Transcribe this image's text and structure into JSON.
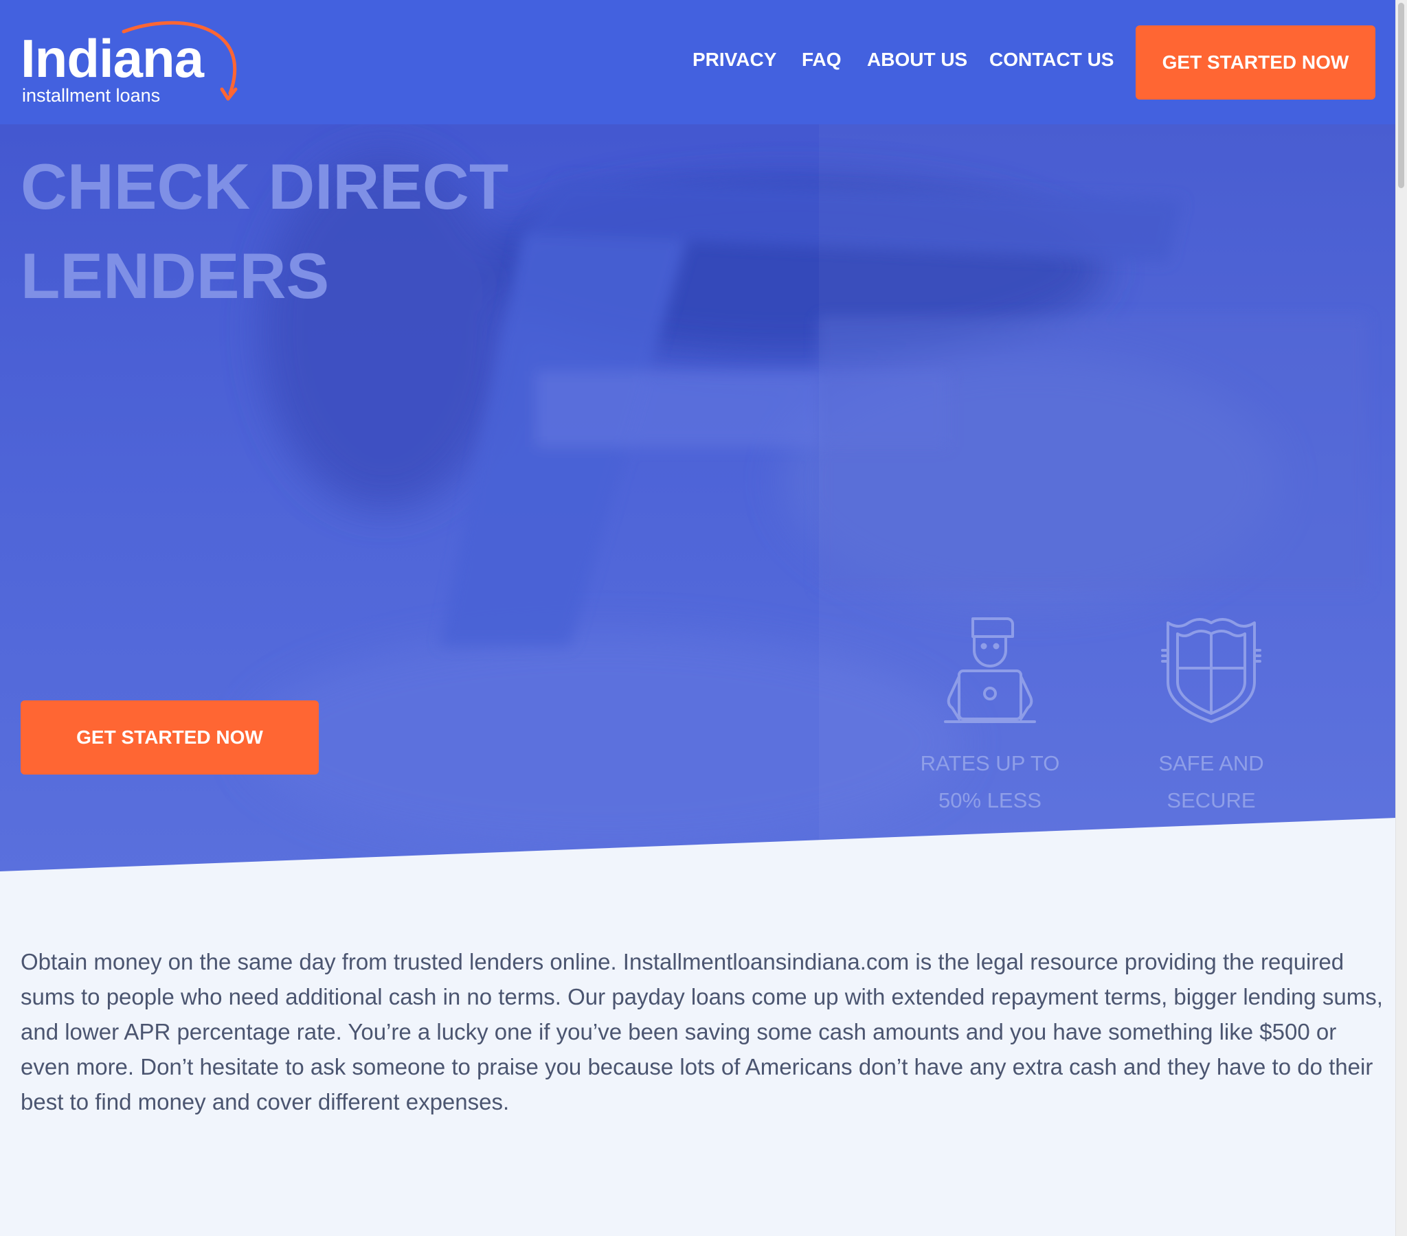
{
  "brand": {
    "name": "Indiana",
    "tagline": "installment loans"
  },
  "nav": {
    "items": [
      {
        "label": "PRIVACY"
      },
      {
        "label": "FAQ"
      },
      {
        "label": "ABOUT US"
      },
      {
        "label": "CONTACT US"
      }
    ],
    "cta_label": "GET STARTED NOW"
  },
  "hero": {
    "title_line1": "CHECK DIRECT",
    "title_line2": "LENDERS",
    "cta_label": "GET STARTED NOW",
    "features": [
      {
        "icon": "person-laptop-icon",
        "label": "RATES UP TO\n50% LESS"
      },
      {
        "icon": "shield-icon",
        "label": "SAFE AND\nSECURE"
      }
    ]
  },
  "content": {
    "paragraph": "Obtain money on the same day from trusted lenders online. Installmentloansindiana.com is the legal resource providing the required sums to people who need additional cash in no terms. Our payday loans come up with extended repayment terms, bigger lending sums, and lower APR percentage rate. You’re a lucky one if you’ve been saving some cash amounts and you have something like $500 or even more. Don’t hesitate to ask someone to praise you because lots of Americans don’t have any extra cash and they have to do their best to find money and cover different expenses."
  },
  "colors": {
    "header_bg": "#4361df",
    "accent": "#ff6633",
    "page_bg": "#f1f5fc",
    "body_text": "#4b5570"
  }
}
